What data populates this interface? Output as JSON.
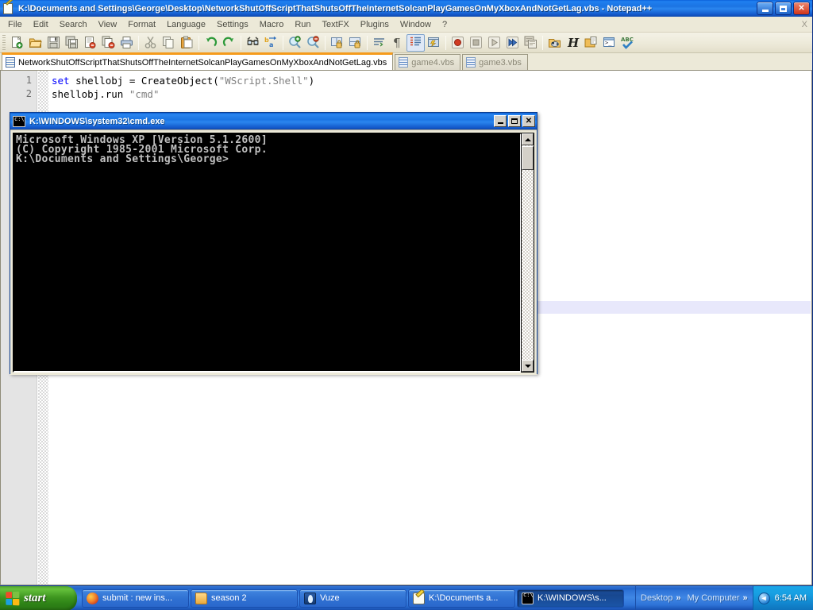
{
  "window": {
    "title": "K:\\Documents and Settings\\George\\Desktop\\NetworkShutOffScriptThatShutsOffTheInternetSolcanPlayGamesOnMyXboxAndNotGetLag.vbs - Notepad++",
    "icon": "notepad-plus-plus-icon",
    "caption": {
      "minimize": "Minimize",
      "maximize": "Maximize",
      "close": "Close"
    },
    "menubar_close_label": "X"
  },
  "menubar": {
    "items": [
      {
        "label": "File"
      },
      {
        "label": "Edit"
      },
      {
        "label": "Search"
      },
      {
        "label": "View"
      },
      {
        "label": "Format"
      },
      {
        "label": "Language"
      },
      {
        "label": "Settings"
      },
      {
        "label": "Macro"
      },
      {
        "label": "Run"
      },
      {
        "label": "TextFX"
      },
      {
        "label": "Plugins"
      },
      {
        "label": "Window"
      },
      {
        "label": "?"
      }
    ]
  },
  "toolbar": {
    "buttons": [
      {
        "name": "new-file-icon",
        "tip": "New"
      },
      {
        "name": "open-file-icon",
        "tip": "Open"
      },
      {
        "name": "save-icon",
        "tip": "Save"
      },
      {
        "name": "save-all-icon",
        "tip": "Save All"
      },
      {
        "name": "close-file-icon",
        "tip": "Close"
      },
      {
        "name": "close-all-files-icon",
        "tip": "Close All"
      },
      {
        "name": "print-icon",
        "tip": "Print"
      },
      {
        "name": "sep"
      },
      {
        "name": "cut-icon",
        "tip": "Cut"
      },
      {
        "name": "copy-icon",
        "tip": "Copy"
      },
      {
        "name": "paste-icon",
        "tip": "Paste"
      },
      {
        "name": "sep"
      },
      {
        "name": "undo-icon",
        "tip": "Undo"
      },
      {
        "name": "redo-icon",
        "tip": "Redo"
      },
      {
        "name": "sep"
      },
      {
        "name": "find-icon",
        "tip": "Find"
      },
      {
        "name": "replace-icon",
        "tip": "Replace"
      },
      {
        "name": "sep"
      },
      {
        "name": "zoom-in-icon",
        "tip": "Zoom In"
      },
      {
        "name": "zoom-out-icon",
        "tip": "Zoom Out"
      },
      {
        "name": "sep"
      },
      {
        "name": "sync-vertical-icon",
        "tip": "Synchronize Vertical Scrolling"
      },
      {
        "name": "sync-horizontal-icon",
        "tip": "Synchronize Horizontal Scrolling"
      },
      {
        "name": "sep"
      },
      {
        "name": "word-wrap-icon",
        "tip": "Word wrap"
      },
      {
        "name": "show-all-chars-icon",
        "tip": "Show All Characters"
      },
      {
        "name": "indent-guide-icon",
        "tip": "Show Indent Guide"
      },
      {
        "name": "user-define-dialog-icon",
        "tip": "User Defined Dialogue"
      },
      {
        "name": "sep"
      },
      {
        "name": "record-macro-icon",
        "tip": "Start Recording"
      },
      {
        "name": "stop-macro-icon",
        "tip": "Stop Recording"
      },
      {
        "name": "play-macro-icon",
        "tip": "Play Macro"
      },
      {
        "name": "run-macro-multiple-icon",
        "tip": "Run Macro Multiple Times"
      },
      {
        "name": "save-macro-icon",
        "tip": "Save Current Recorded Macro"
      },
      {
        "name": "sep"
      },
      {
        "name": "run-icon",
        "tip": "Run"
      },
      {
        "name": "tidy-html-icon",
        "tip": "HTML Tidy"
      },
      {
        "name": "open-folder-icon",
        "tip": "Open containing folder"
      },
      {
        "name": "open-console-icon",
        "tip": "Open console"
      },
      {
        "name": "spellcheck-icon",
        "tip": "Spell Check"
      }
    ]
  },
  "tabs": [
    {
      "label": "NetworkShutOffScriptThatShutsOffTheInternetSolcanPlayGamesOnMyXboxAndNotGetLag.vbs",
      "active": true
    },
    {
      "label": "game4.vbs",
      "active": false
    },
    {
      "label": "game3.vbs",
      "active": false
    }
  ],
  "editor": {
    "lines": [
      {
        "number": "1",
        "tokens": [
          {
            "text": "set",
            "type": "kw"
          },
          {
            "text": " shellobj = CreateObject(",
            "type": "fn"
          },
          {
            "text": "\"WScript.Shell\"",
            "type": "str"
          },
          {
            "text": ")",
            "type": "fn"
          }
        ]
      },
      {
        "number": "2",
        "tokens": [
          {
            "text": "shellobj.run ",
            "type": "fn"
          },
          {
            "text": "\"cmd\"",
            "type": "str"
          }
        ]
      }
    ],
    "current_line_highlight_color": "#e8e8fb"
  },
  "cmd_window": {
    "title": "K:\\WINDOWS\\system32\\cmd.exe",
    "icon": "cmd-console-icon",
    "caption": {
      "minimize": "Minimize",
      "maximize": "Maximize",
      "close": "Close"
    },
    "console_lines": [
      "Microsoft Windows XP [Version 5.1.2600]",
      "(C) Copyright 1985-2001 Microsoft Corp.",
      "",
      "K:\\Documents and Settings\\George>"
    ],
    "scrollbar": {
      "up_arrow": "scroll-up-arrow",
      "down_arrow": "scroll-down-arrow",
      "thumb": "scroll-thumb"
    }
  },
  "taskbar": {
    "start_label": "start",
    "tasks": [
      {
        "label": "submit : new ins...",
        "icon": "firefox-icon",
        "icon_class": "ti-firefox",
        "active": false
      },
      {
        "label": "season 2",
        "icon": "folder-icon",
        "icon_class": "ti-folder",
        "active": false
      },
      {
        "label": "Vuze",
        "icon": "vuze-icon",
        "icon_class": "ti-vuze",
        "active": false
      },
      {
        "label": "K:\\Documents a...",
        "icon": "notepad-plus-plus-icon",
        "icon_class": "ti-npp",
        "active": false
      },
      {
        "label": "K:\\WINDOWS\\s...",
        "icon": "cmd-console-icon",
        "icon_class": "ti-cmd",
        "active": true
      }
    ],
    "deskbands": [
      {
        "label": "Desktop",
        "chevron": "»"
      },
      {
        "label": "My Computer",
        "chevron": "»"
      }
    ],
    "tray": {
      "expand_icon": "◄",
      "clock": "6:54 AM"
    }
  },
  "colors": {
    "xp_blue_titlebar": "#1b74e2",
    "xp_taskbar_blue": "#2f74d8",
    "start_green": "#3e9620",
    "npp_tab_accent": "#f59b1c",
    "desktop_blue": "#3a6ea5",
    "console_black": "#000000",
    "console_text": "#c0c0c0",
    "keyword_blue": "#0000ff",
    "string_gray": "#808080"
  }
}
